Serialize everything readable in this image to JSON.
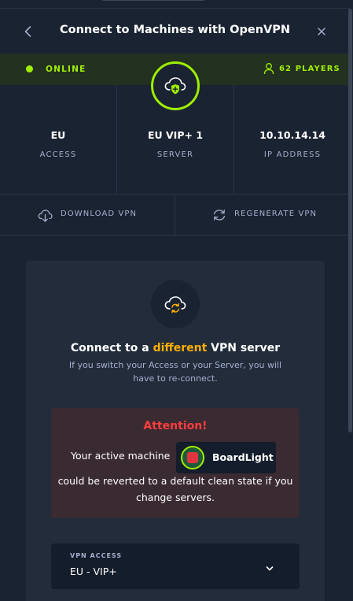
{
  "header": {
    "title": "Connect to Machines with OpenVPN"
  },
  "status": {
    "online_label": "ONLINE",
    "players_label": "62 PLAYERS"
  },
  "info": {
    "access": {
      "value": "EU",
      "label": "ACCESS"
    },
    "server": {
      "value": "EU VIP+ 1",
      "label": "SERVER"
    },
    "ip": {
      "value": "10.10.14.14",
      "label": "IP ADDRESS"
    }
  },
  "actions": {
    "download_label": "DOWNLOAD VPN",
    "regenerate_label": "REGENERATE VPN"
  },
  "card": {
    "title_prefix": "Connect to a ",
    "title_highlight": "different",
    "title_suffix": " VPN server",
    "subtitle": "If you switch your Access or your Server, you will have to re-connect."
  },
  "attention": {
    "title": "Attention!",
    "text_before": "Your active machine",
    "machine_name": "BoardLight",
    "text_after": "could be reverted to a default clean state if you change servers."
  },
  "vpn_access": {
    "label": "VPN ACCESS",
    "value": "EU - VIP+"
  },
  "colors": {
    "accent_green": "#9fef00",
    "accent_orange": "#ffaf00",
    "alert_red": "#ff3e3e",
    "panel_bg": "#1a2332"
  },
  "icons": {
    "back": "chevron-left-icon",
    "close": "close-icon",
    "status": "online-dot",
    "players": "user-icon",
    "badge": "cloud-shield-icon",
    "download": "cloud-download-icon",
    "regenerate": "refresh-icon",
    "card": "cloud-refresh-icon",
    "select": "chevron-down-icon"
  }
}
